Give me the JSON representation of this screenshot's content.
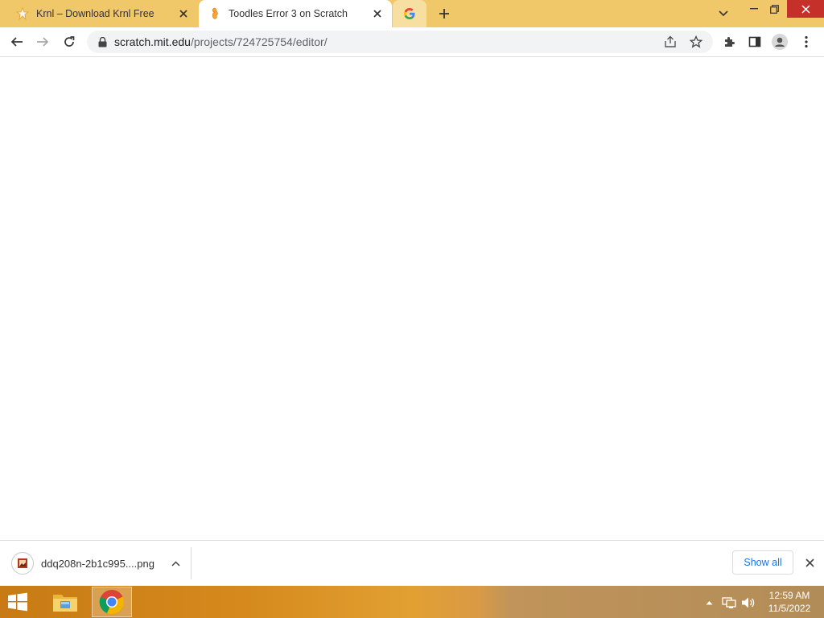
{
  "browser": {
    "tabs": [
      {
        "title": "Krnl – Download Krnl Free",
        "favicon": "krnl-logo-icon",
        "active": false
      },
      {
        "title": "Toodles Error 3 on Scratch",
        "favicon": "scratch-cat-icon",
        "active": true
      },
      {
        "title": "",
        "favicon": "google-g-icon",
        "active": false
      }
    ],
    "address": {
      "domain": "scratch.mit.edu",
      "path": "/projects/724725754/editor/"
    },
    "colors": {
      "tabstrip": "#f0c86a",
      "close_red": "#c5312a"
    }
  },
  "download_shelf": {
    "filename": "ddq208n-2b1c995....png",
    "show_all_label": "Show all"
  },
  "taskbar": {
    "apps": [
      "windows-start-icon",
      "file-explorer-icon",
      "chrome-icon"
    ],
    "tray": [
      "show-hidden-icons-icon",
      "network-icon",
      "volume-icon"
    ],
    "time": "12:59 AM",
    "date": "11/5/2022"
  }
}
